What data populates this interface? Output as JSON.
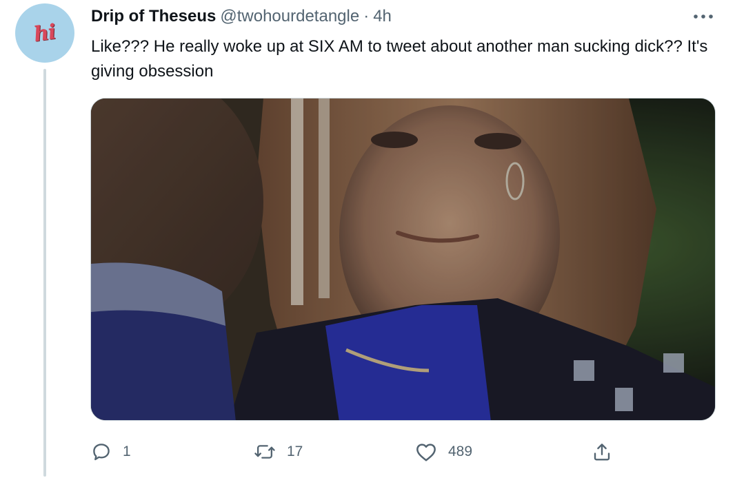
{
  "tweet": {
    "avatar_text": "hi",
    "display_name": "Drip of Theseus",
    "handle": "@twohourdetangle",
    "separator": "·",
    "time": "4h",
    "text": "Like??? He really woke up at SIX AM to tweet about another man sucking dick?? It's giving obsession"
  },
  "media": {
    "type": "image",
    "icon": "photo"
  },
  "actions": {
    "reply": {
      "icon": "reply-icon",
      "count": "1"
    },
    "retweet": {
      "icon": "retweet-icon",
      "count": "17"
    },
    "like": {
      "icon": "heart-icon",
      "count": "489"
    },
    "share": {
      "icon": "share-icon"
    }
  },
  "colors": {
    "text_primary": "#0f1419",
    "text_secondary": "#536471",
    "border": "#cfd9de",
    "avatar_bg": "#a9d3ea",
    "avatar_text": "#d9475a"
  }
}
